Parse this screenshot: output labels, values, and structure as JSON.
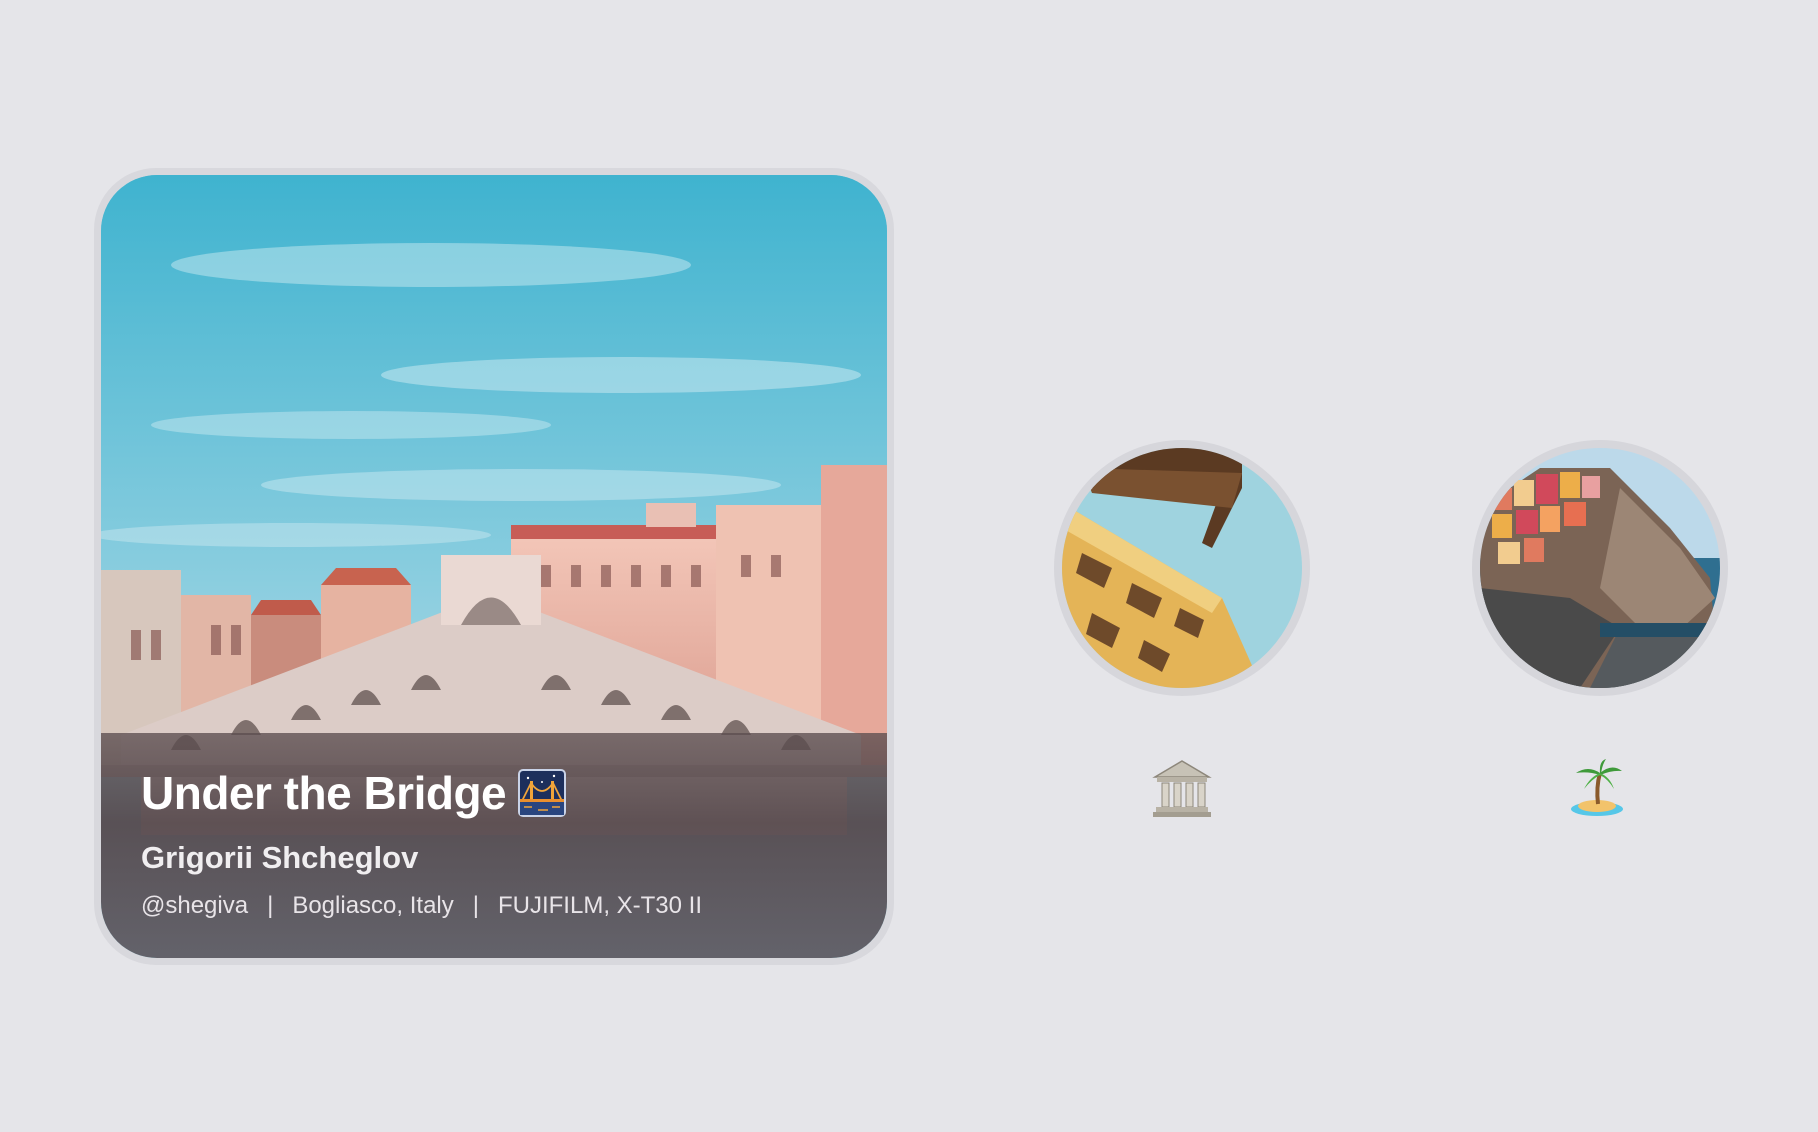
{
  "featured": {
    "title": "Under the Bridge",
    "title_icon": "night-bridge-emoji-icon",
    "author": "Grigorii Shcheglov",
    "meta": {
      "handle": "@shegiva",
      "separator": "|",
      "location": "Bogliasco, Italy",
      "camera": "FUJIFILM, X-T30 II"
    }
  },
  "thumbnails": [
    {
      "name": "building-photo",
      "emoji": "classical-building-emoji-icon"
    },
    {
      "name": "coastal-village-photo",
      "emoji": "desert-island-emoji-icon"
    }
  ],
  "colors": {
    "background": "#e5e5e9",
    "sky": "#6fc1d6",
    "text": "#ffffff"
  }
}
